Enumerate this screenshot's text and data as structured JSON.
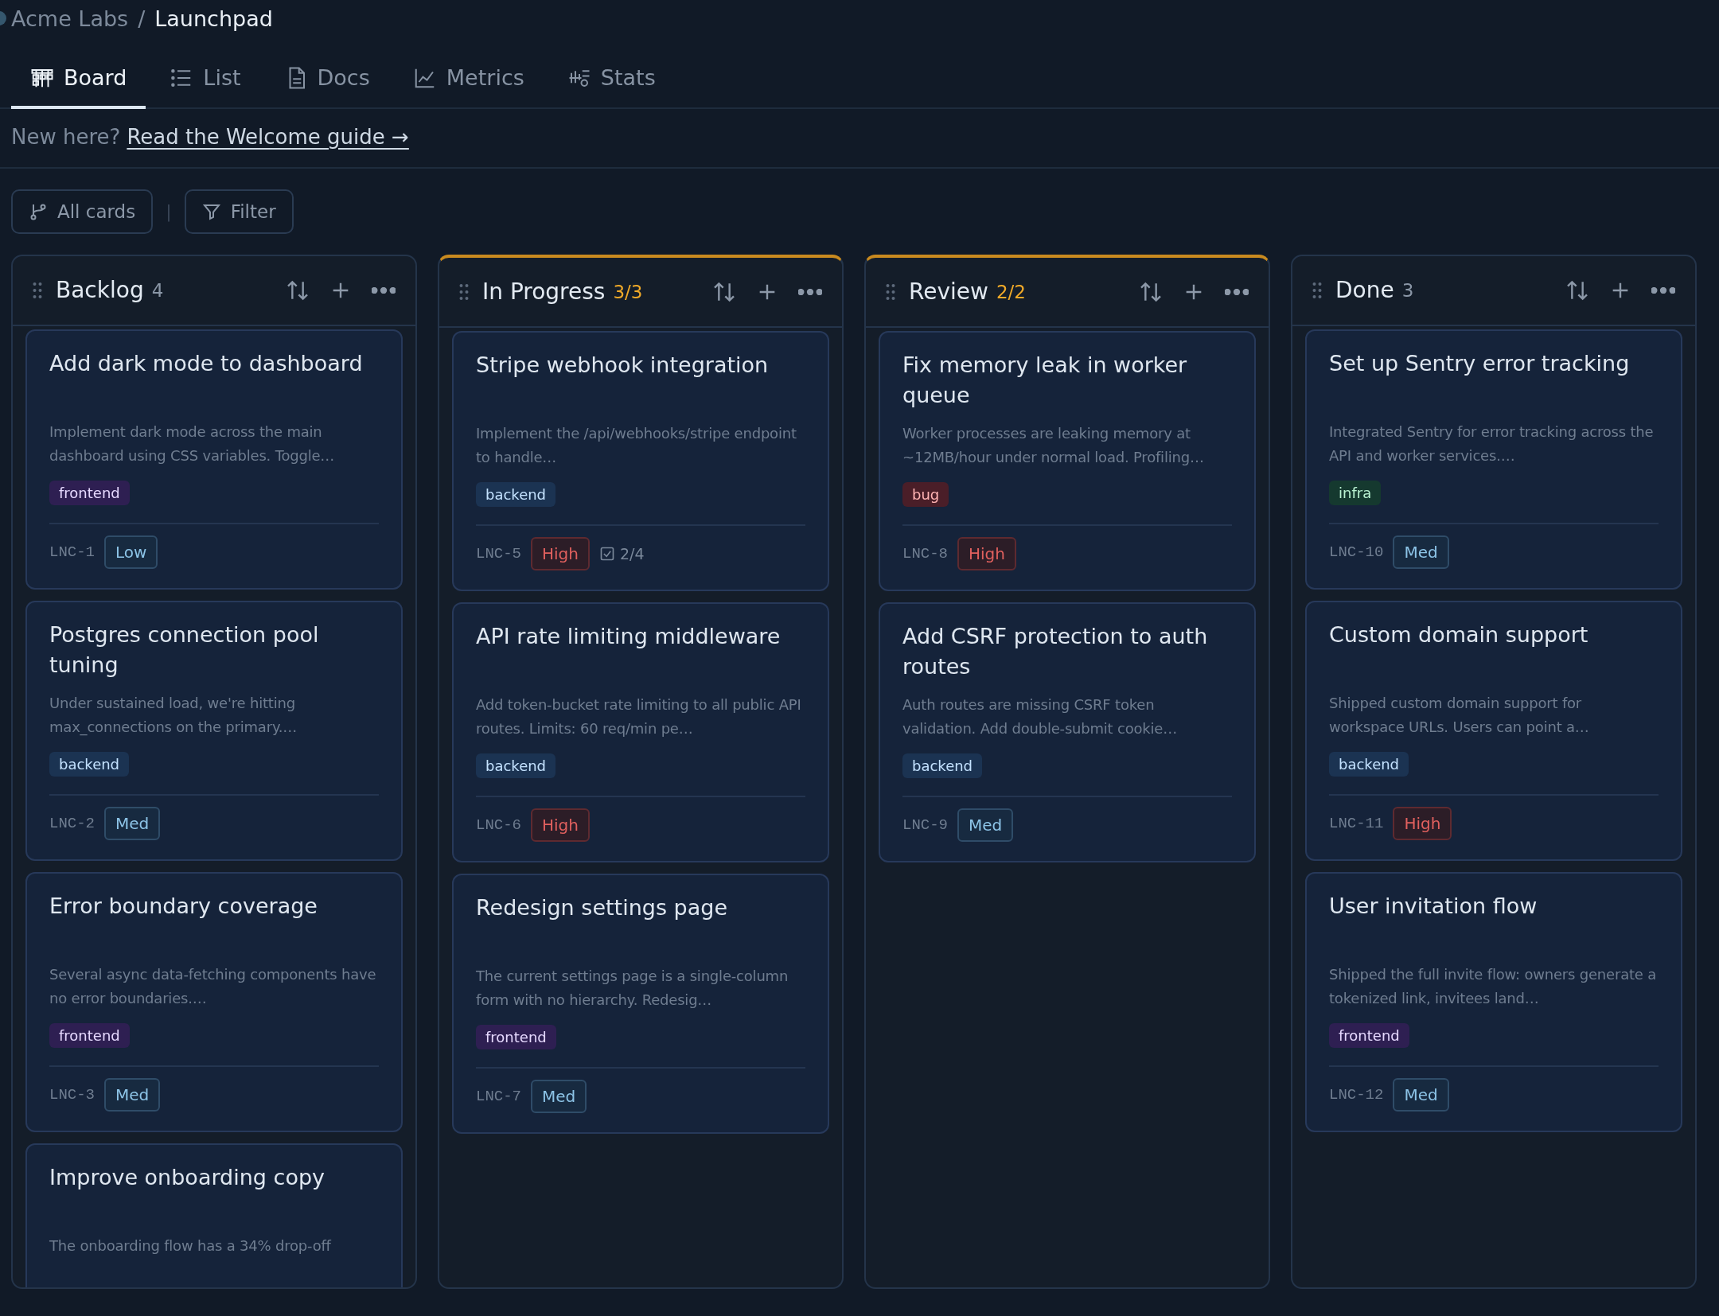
{
  "breadcrumb": {
    "org": "Acme Labs",
    "separator": "/",
    "project": "Launchpad"
  },
  "tabs": [
    {
      "label": "Board",
      "selected": true
    },
    {
      "label": "List",
      "selected": false
    },
    {
      "label": "Docs",
      "selected": false
    },
    {
      "label": "Metrics",
      "selected": false
    },
    {
      "label": "Stats",
      "selected": false
    }
  ],
  "banner": {
    "text": "New here?",
    "link": "Read the Welcome guide →"
  },
  "toolbar": {
    "view_button": "All cards",
    "separator": "|",
    "filter_button": "Filter"
  },
  "columns": [
    {
      "title": "Backlog",
      "count": "4",
      "at_limit": false,
      "cards": [
        {
          "title": "Add dark mode to dashboard",
          "description": "Implement dark mode across the main dashboard using CSS variables. Toggle…",
          "tag": {
            "label": "frontend",
            "kind": "frontend"
          },
          "id": "LNC-1",
          "priority": {
            "label": "Low",
            "kind": "normal"
          }
        },
        {
          "title": "Postgres connection pool tuning",
          "description": "Under sustained load, we're hitting max_connections on the primary.…",
          "tag": {
            "label": "backend",
            "kind": "backend"
          },
          "id": "LNC-2",
          "priority": {
            "label": "Med",
            "kind": "normal"
          }
        },
        {
          "title": "Error boundary coverage",
          "description": "Several async data-fetching components have no error boundaries.…",
          "tag": {
            "label": "frontend",
            "kind": "frontend"
          },
          "id": "LNC-3",
          "priority": {
            "label": "Med",
            "kind": "normal"
          }
        },
        {
          "title": "Improve onboarding copy",
          "description": "The onboarding flow has a 34% drop-off"
        }
      ]
    },
    {
      "title": "In Progress",
      "count": "3/3",
      "at_limit": true,
      "cards": [
        {
          "title": "Stripe webhook integration",
          "description": "Implement the /api/webhooks/stripe endpoint to handle…",
          "tag": {
            "label": "backend",
            "kind": "backend"
          },
          "id": "LNC-5",
          "priority": {
            "label": "High",
            "kind": "high"
          },
          "checklist": "2/4"
        },
        {
          "title": "API rate limiting middleware",
          "description": "Add token-bucket rate limiting to all public API routes. Limits: 60 req/min pe…",
          "tag": {
            "label": "backend",
            "kind": "backend"
          },
          "id": "LNC-6",
          "priority": {
            "label": "High",
            "kind": "high"
          }
        },
        {
          "title": "Redesign settings page",
          "description": "The current settings page is a single-column form with no hierarchy. Redesig…",
          "tag": {
            "label": "frontend",
            "kind": "frontend"
          },
          "id": "LNC-7",
          "priority": {
            "label": "Med",
            "kind": "normal"
          }
        }
      ]
    },
    {
      "title": "Review",
      "count": "2/2",
      "at_limit": true,
      "cards": [
        {
          "title": "Fix memory leak in worker queue",
          "description": "Worker processes are leaking memory at ~12MB/hour under normal load. Profiling…",
          "tag": {
            "label": "bug",
            "kind": "bug"
          },
          "id": "LNC-8",
          "priority": {
            "label": "High",
            "kind": "high"
          }
        },
        {
          "title": "Add CSRF protection to auth routes",
          "description": "Auth routes are missing CSRF token validation. Add double-submit cookie…",
          "tag": {
            "label": "backend",
            "kind": "backend"
          },
          "id": "LNC-9",
          "priority": {
            "label": "Med",
            "kind": "normal"
          }
        }
      ]
    },
    {
      "title": "Done",
      "count": "3",
      "at_limit": false,
      "cards": [
        {
          "title": "Set up Sentry error tracking",
          "description": "Integrated Sentry for error tracking across the API and worker services.…",
          "tag": {
            "label": "infra",
            "kind": "infra"
          },
          "id": "LNC-10",
          "priority": {
            "label": "Med",
            "kind": "normal"
          }
        },
        {
          "title": "Custom domain support",
          "description": "Shipped custom domain support for workspace URLs. Users can point a…",
          "tag": {
            "label": "backend",
            "kind": "backend"
          },
          "id": "LNC-11",
          "priority": {
            "label": "High",
            "kind": "high"
          }
        },
        {
          "title": "User invitation flow",
          "description": "Shipped the full invite flow: owners generate a tokenized link, invitees land…",
          "tag": {
            "label": "frontend",
            "kind": "frontend"
          },
          "id": "LNC-12",
          "priority": {
            "label": "Med",
            "kind": "normal"
          }
        }
      ]
    }
  ]
}
